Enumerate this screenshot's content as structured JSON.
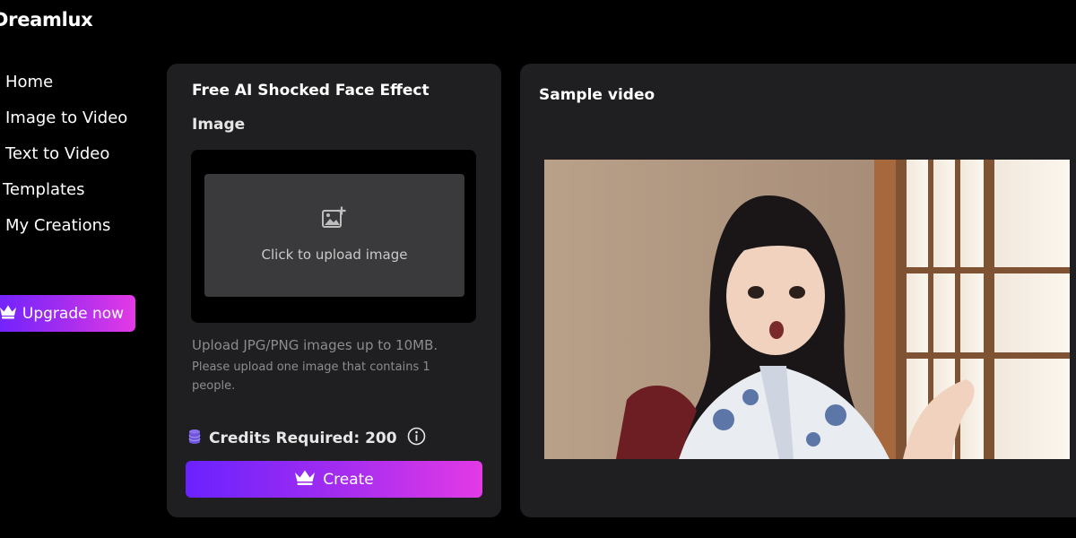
{
  "brand": {
    "name": "Dreamlux"
  },
  "nav": {
    "items": [
      {
        "label": "Home"
      },
      {
        "label": "Image to Video"
      },
      {
        "label": "Text to Video"
      },
      {
        "label": "Templates"
      },
      {
        "label": "My Creations"
      }
    ]
  },
  "upgrade": {
    "label": "Upgrade now",
    "icon": "crown-icon"
  },
  "effect_panel": {
    "title": "Free AI Shocked Face Effect",
    "image_label": "Image",
    "upload": {
      "text": "Click to upload image",
      "icon": "add-image-icon"
    },
    "hint_format": "Upload JPG/PNG images up to 10MB.",
    "hint_people": "Please upload one image that contains 1 people.",
    "credits": {
      "text": "Credits Required: 200",
      "icon": "coins-icon",
      "info_icon": "info-icon"
    },
    "create": {
      "label": "Create",
      "icon": "crown-icon"
    }
  },
  "sample_panel": {
    "title": "Sample video"
  },
  "colors": {
    "background": "#000000",
    "panel": "#1f1f21",
    "upload_box": "#3a3a3c",
    "gradient_start": "#6a22ff",
    "gradient_end": "#e33ae5",
    "muted_text": "#8c8c8c"
  }
}
